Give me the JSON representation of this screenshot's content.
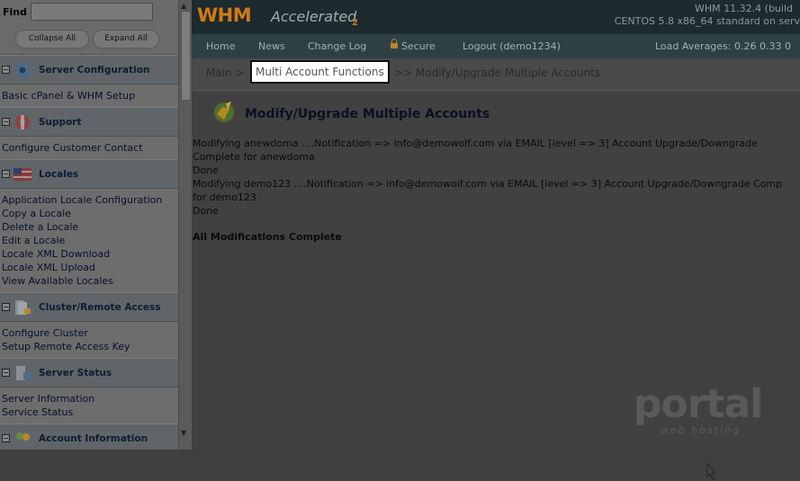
{
  "sidebar": {
    "find_label": "Find",
    "collapse_label": "Collapse All",
    "expand_label": "Expand All",
    "categories": [
      {
        "title": "Server Configuration",
        "items": [
          "Basic cPanel & WHM Setup"
        ]
      },
      {
        "title": "Support",
        "items": [
          "Configure Customer Contact"
        ]
      },
      {
        "title": "Locales",
        "items": [
          "Application Locale Configuration",
          "Copy a Locale",
          "Delete a Locale",
          "Edit a Locale",
          "Locale XML Download",
          "Locale XML Upload",
          "View Available Locales"
        ]
      },
      {
        "title": "Cluster/Remote Access",
        "items": [
          "Configure Cluster",
          "Setup Remote Access Key"
        ]
      },
      {
        "title": "Server Status",
        "items": [
          "Server Information",
          "Service Status"
        ]
      },
      {
        "title": "Account Information",
        "items": []
      }
    ]
  },
  "header": {
    "logo_main": "WHM",
    "logo_accel": "Accelerated",
    "logo_sub": "2",
    "version_line1": "WHM 11.32.4 (build",
    "version_line2": "CENTOS 5.8 x86_64 standard on serv"
  },
  "nav": {
    "home": "Home",
    "news": "News",
    "changelog": "Change Log",
    "secure": "Secure",
    "logout": "Logout (demo1234)",
    "load": "Load Averages: 0.26 0.33 0"
  },
  "breadcrumb": {
    "main": "Main >",
    "section": "Multi Account Functions",
    "current": ">> Modify/Upgrade Multiple Accounts"
  },
  "page": {
    "title": "Modify/Upgrade Multiple Accounts",
    "log": [
      "Modifying anewdoma ....Notification => info@demowolf.com via EMAIL [level => 3] Account Upgrade/Downgrade",
      "Complete for anewdoma",
      "Done",
      "Modifying demo123 ....Notification => info@demowolf.com via EMAIL [level => 3] Account Upgrade/Downgrade Comp",
      "for demo123",
      "Done"
    ],
    "complete": "All Modifications Complete"
  },
  "watermark": {
    "brand": "portal",
    "sub": "web hosting"
  },
  "colors": {
    "logo_orange": "#d27a14",
    "header_bg": "#1d2a2e",
    "nav_bg": "#2f4044"
  }
}
